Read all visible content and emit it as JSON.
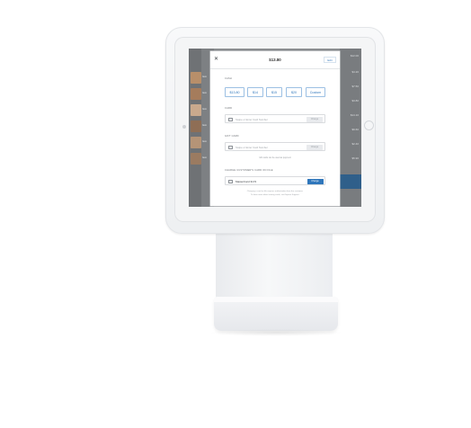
{
  "modal": {
    "close_icon": "close-icon",
    "title": "$13.80",
    "edit_label": "Edit"
  },
  "cash": {
    "label": "CASH",
    "options": [
      "$13.80",
      "$14",
      "$15",
      "$20",
      "Custom"
    ]
  },
  "card": {
    "label": "CARD",
    "placeholder": "Swipe or Enter Card Number",
    "button": "Charge"
  },
  "gift_card": {
    "label": "GIFT CARD",
    "placeholder": "Swipe or Enter Card Number",
    "button": "Charge",
    "note": "Gift cards can be used as payment"
  },
  "card_on_file": {
    "label": "CHARGE CUSTOMER'S CARD ON FILE",
    "card_text": "MasterCard 3172",
    "button": "Charge"
  },
  "footer": {
    "line1": "Charging a card on file requires authorization from the customer.",
    "line2": "To learn more about storing cards, visit Square Support."
  },
  "background": {
    "prices": [
      "$12.00",
      "$4.20",
      "$7.50",
      "$3.80",
      "$14.10",
      "$9.60",
      "$2.40",
      "$5.90"
    ],
    "items": [
      "Item",
      "Item",
      "Item",
      "Item",
      "Item",
      "Item"
    ]
  }
}
